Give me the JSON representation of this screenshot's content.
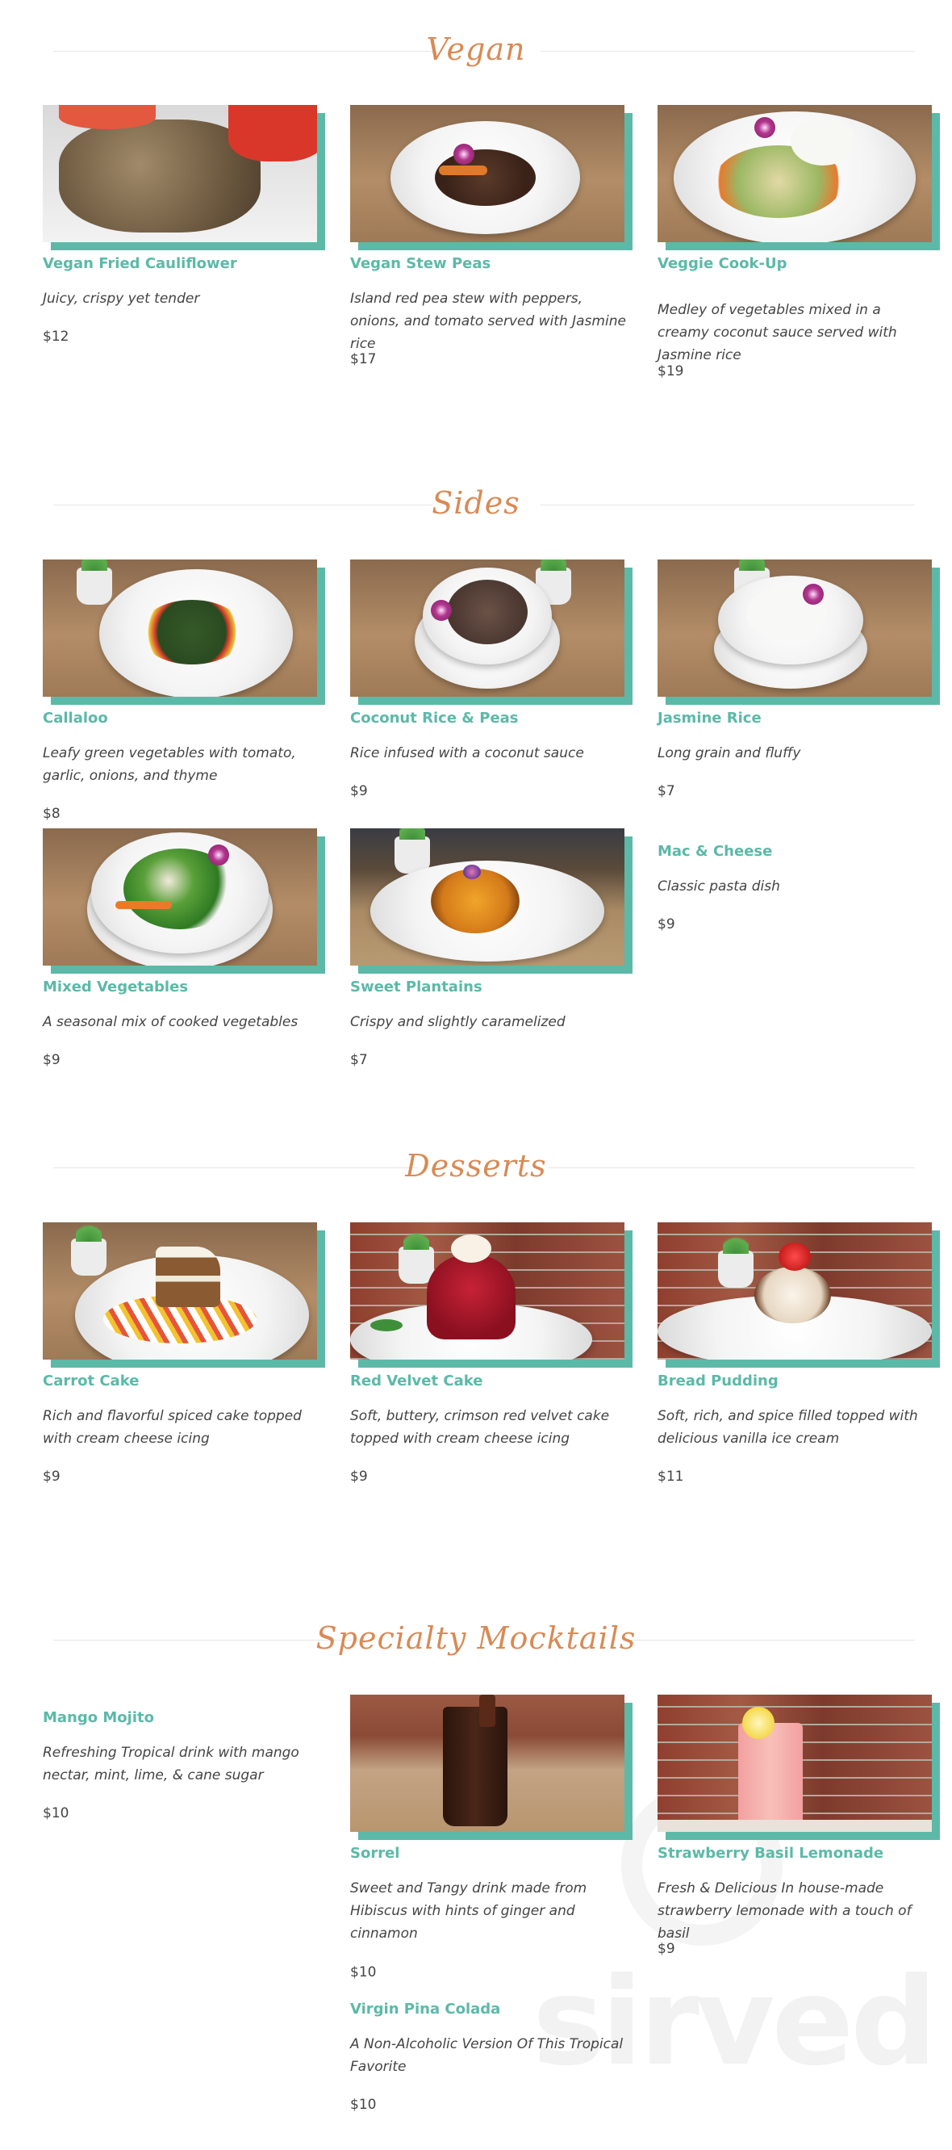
{
  "sections": {
    "vegan": {
      "title": "Vegan",
      "items": [
        {
          "name": "Vegan Fried Cauliflower",
          "description": "Juicy, crispy yet tender",
          "price": "$12"
        },
        {
          "name": "Vegan Stew Peas",
          "description": "Island red pea stew with peppers, onions, and tomato served with Jasmine rice",
          "price": "$17"
        },
        {
          "name": "Veggie Cook-Up",
          "description": "Medley of vegetables mixed in a creamy coconut sauce served with Jasmine rice",
          "price": "$19"
        }
      ]
    },
    "sides": {
      "title": "Sides",
      "items": [
        {
          "name": "Callaloo",
          "description": "Leafy green vegetables with tomato, garlic, onions, and thyme",
          "price": "$8"
        },
        {
          "name": "Coconut Rice & Peas",
          "description": "Rice infused with a coconut sauce",
          "price": "$9"
        },
        {
          "name": "Jasmine Rice",
          "description": "Long grain and fluffy",
          "price": "$7"
        },
        {
          "name": "Mixed Vegetables",
          "description": "A seasonal mix of cooked vegetables",
          "price": "$9"
        },
        {
          "name": "Sweet Plantains",
          "description": "Crispy and slightly caramelized",
          "price": "$7"
        },
        {
          "name": "Mac & Cheese",
          "description": "Classic pasta dish",
          "price": "$9"
        }
      ]
    },
    "desserts": {
      "title": "Desserts",
      "items": [
        {
          "name": "Carrot Cake",
          "description": "Rich and flavorful spiced cake topped with cream cheese icing",
          "price": "$9"
        },
        {
          "name": "Red Velvet Cake",
          "description": "Soft, buttery, crimson red velvet cake topped with cream cheese icing",
          "price": "$9"
        },
        {
          "name": "Bread Pudding",
          "description": "Soft, rich, and spice filled topped with delicious vanilla ice cream",
          "price": "$11"
        }
      ]
    },
    "mocktails": {
      "title": "Specialty Mocktails",
      "items": [
        {
          "name": "Mango Mojito",
          "description": "Refreshing Tropical drink with mango nectar, mint, lime, & cane sugar",
          "price": "$10"
        },
        {
          "name": "Sorrel",
          "description": "Sweet and Tangy drink made from Hibiscus with hints of ginger and cinnamon",
          "price": "$10"
        },
        {
          "name": "Strawberry Basil Lemonade",
          "description": "Fresh & Delicious In house-made strawberry lemonade with a touch of basil",
          "price": "$9"
        },
        {
          "name": "Virgin Pina Colada",
          "description": "A Non-Alcoholic Version Of This Tropical Favorite",
          "price": "$10"
        }
      ]
    }
  },
  "watermark": "sirved",
  "colors": {
    "accent_teal": "#5cb9a8",
    "heading_orange": "#d98a55",
    "text": "#444444"
  }
}
